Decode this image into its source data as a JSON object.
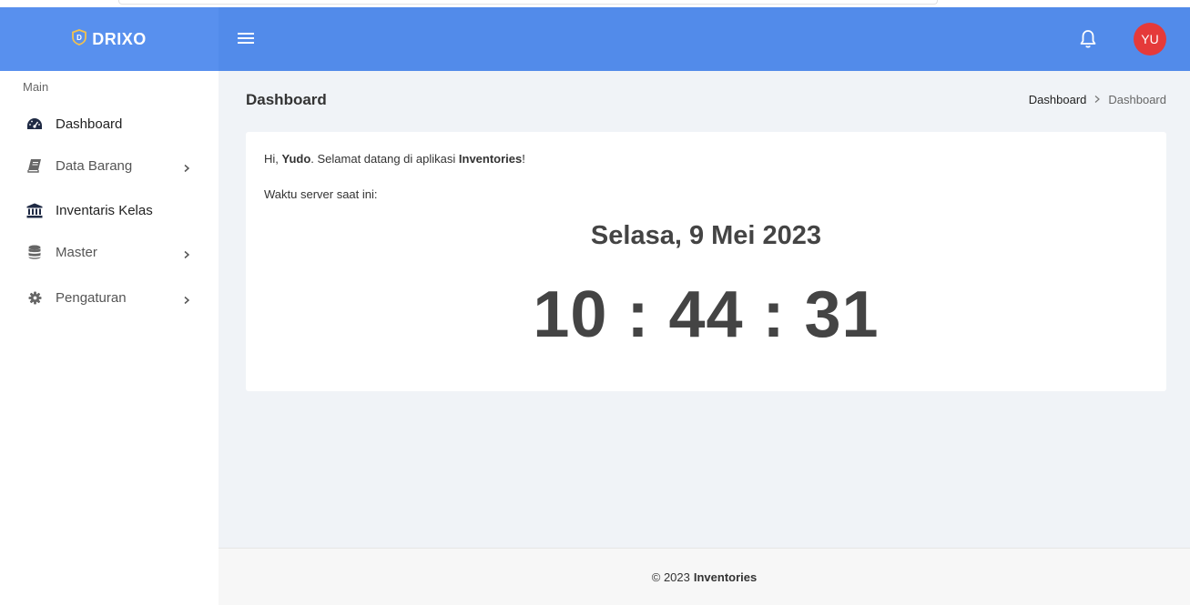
{
  "header": {
    "brand": "DRIXO",
    "avatar_initials": "YU",
    "colors": {
      "bar": "#528bea",
      "brand_bg": "#5890ee",
      "avatar": "#e53a3a"
    }
  },
  "sidebar": {
    "section_title": "Main",
    "items": [
      {
        "label": "Dashboard",
        "icon": "tachometer-icon",
        "has_children": false
      },
      {
        "label": "Data Barang",
        "icon": "book-icon",
        "has_children": true
      },
      {
        "label": "Inventaris Kelas",
        "icon": "bank-icon",
        "has_children": false
      },
      {
        "label": "Master",
        "icon": "database-icon",
        "has_children": true
      },
      {
        "label": "Pengaturan",
        "icon": "gear-icon",
        "has_children": true
      }
    ]
  },
  "page": {
    "title": "Dashboard",
    "breadcrumb": [
      "Dashboard",
      "Dashboard"
    ]
  },
  "card": {
    "greeting_prefix": "Hi, ",
    "user_name": "Yudo",
    "greeting_middle": ". Selamat datang di aplikasi ",
    "app_name": "Inventories",
    "greeting_suffix": "!",
    "server_time_label": "Waktu server saat ini:",
    "date": "Selasa, 9 Mei 2023",
    "time": "10 : 44 : 31"
  },
  "footer": {
    "copyright": "© 2023",
    "app_name": "Inventories"
  }
}
